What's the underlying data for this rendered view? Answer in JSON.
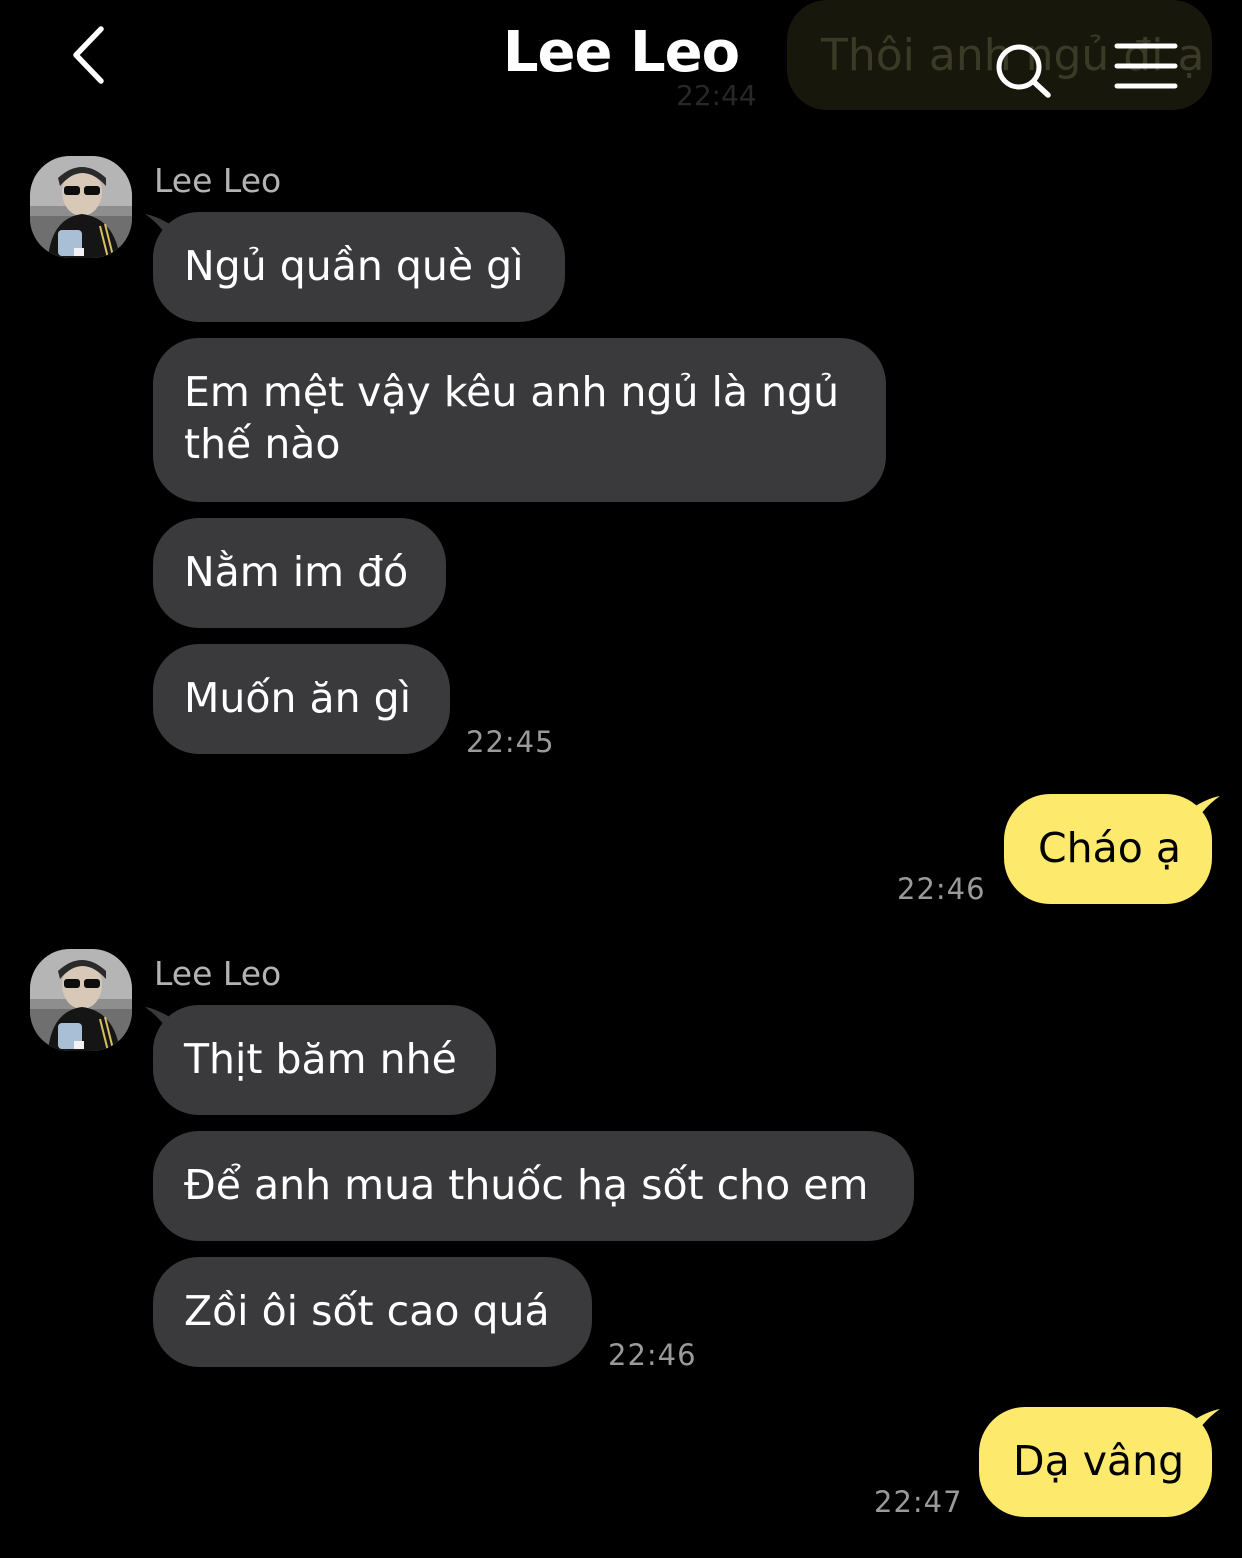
{
  "header": {
    "title": "Lee Leo",
    "back_icon": "chevron-left-icon",
    "search_icon": "search-icon",
    "menu_icon": "hamburger-menu-icon"
  },
  "background_preview": {
    "text": "Thôi anh ngủ đi ạ",
    "time": "22:44"
  },
  "colors": {
    "background": "#000000",
    "incoming_bubble": "#3a3a3c",
    "outgoing_bubble": "#fde96b",
    "timestamp": "#9a9a9a",
    "sender_name": "#b3b3b3"
  },
  "messages": {
    "group1": {
      "sender": "Lee Leo",
      "lines": [
        "Ngủ quần què gì",
        "Em mệt vậy kêu anh ngủ là ngủ",
        "thế nào",
        "Nằm im đó",
        "Muốn ăn gì"
      ],
      "time": "22:45"
    },
    "reply1": {
      "text": "Cháo ạ",
      "time": "22:46"
    },
    "group2": {
      "sender": "Lee Leo",
      "lines": [
        "Thịt băm nhé",
        "Để anh mua thuốc hạ sốt cho em",
        "Zồi ôi sốt cao quá"
      ],
      "time": "22:46"
    },
    "reply2": {
      "text": "Dạ vâng",
      "time": "22:47"
    }
  }
}
